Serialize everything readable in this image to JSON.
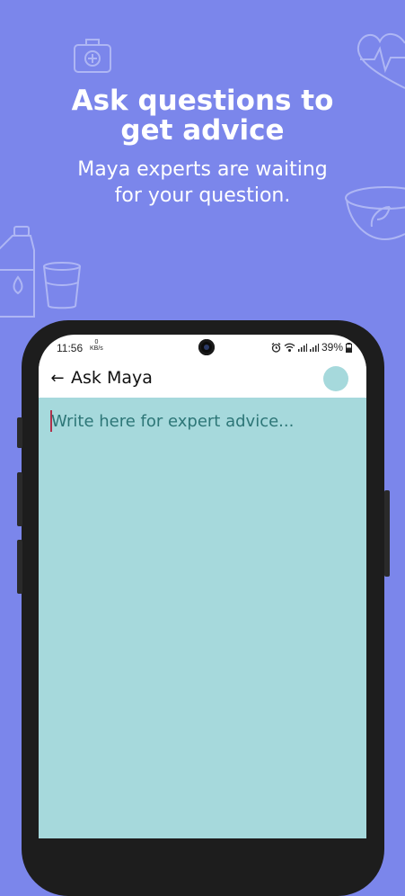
{
  "hero": {
    "headline": "Ask questions to\nget advice",
    "subline": "Maya experts are waiting\nfor your question."
  },
  "status_bar": {
    "time": "11:56",
    "kbs": "0\nKB/s",
    "battery": "39%"
  },
  "app_bar": {
    "title": "Ask Maya",
    "back_icon": "arrow-left-icon"
  },
  "compose": {
    "placeholder": "Write here for expert advice..."
  },
  "colors": {
    "background": "#7b86eb",
    "accent": "#a6d9dc",
    "placeholder_text": "#2d7677"
  }
}
